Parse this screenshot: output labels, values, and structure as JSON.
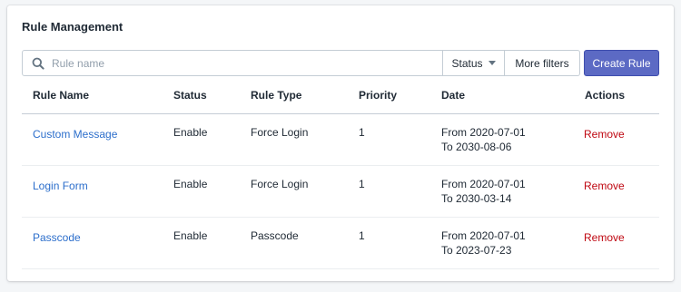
{
  "page_title": "Rule Management",
  "search": {
    "placeholder": "Rule name",
    "value": ""
  },
  "filters": {
    "status_label": "Status",
    "more_label": "More filters"
  },
  "create_button_label": "Create Rule",
  "columns": [
    "Rule Name",
    "Status",
    "Rule Type",
    "Priority",
    "Date",
    "Actions"
  ],
  "rows": [
    {
      "name": "Custom Message",
      "status": "Enable",
      "type": "Force Login",
      "priority": "1",
      "date_from": "From 2020-07-01",
      "date_to": "To 2030-08-06",
      "action": "Remove"
    },
    {
      "name": "Login Form",
      "status": "Enable",
      "type": "Force Login",
      "priority": "1",
      "date_from": "From 2020-07-01",
      "date_to": "To 2030-03-14",
      "action": "Remove"
    },
    {
      "name": "Passcode",
      "status": "Enable",
      "type": "Passcode",
      "priority": "1",
      "date_from": "From 2020-07-01",
      "date_to": "To 2023-07-23",
      "action": "Remove"
    }
  ],
  "colors": {
    "primary": "#5c6ac4",
    "link": "#2c6ecb",
    "danger": "#bf0711"
  },
  "icons": {
    "search": "search-icon",
    "caret": "caret-down-icon"
  }
}
